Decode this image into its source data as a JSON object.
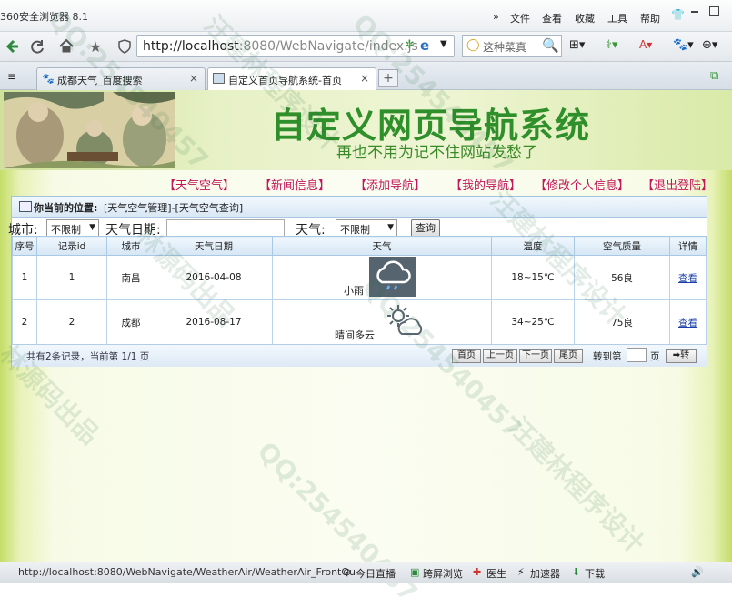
{
  "browser": {
    "app_title": "360安全浏览器 8.1",
    "menu": [
      "»",
      "文件",
      "查看",
      "收藏",
      "工具",
      "帮助"
    ],
    "address_host": "http://localhost",
    "address_rest": ":8080/WebNavigate/index.js",
    "search_placeholder": "这种菜真",
    "tabs": [
      {
        "label": "成都天气_百度搜索",
        "close": "×"
      },
      {
        "label": "自定义首页导航系统-首页",
        "close": "×"
      }
    ],
    "new_tab": "+"
  },
  "banner": {
    "title": "自定义网页导航系统",
    "subtitle": "再也不用为记不住网站发愁了"
  },
  "nav_links": [
    "【天气空气】",
    "【新闻信息】",
    "【添加导航】",
    "【我的导航】",
    "【修改个人信息】",
    "【退出登陆】"
  ],
  "breadcrumb": {
    "label": "你当前的位置:",
    "path": "[天气空气管理]-[天气空气查询]"
  },
  "filters": {
    "city_label": "城市:",
    "city_value": "不限制",
    "date_label": "天气日期:",
    "date_value": "",
    "weather_label": "天气:",
    "weather_value": "不限制",
    "search_button": "查询"
  },
  "table": {
    "headers": [
      "序号",
      "记录id",
      "城市",
      "天气日期",
      "天气",
      "温度",
      "空气质量",
      "详情"
    ],
    "rows": [
      {
        "index": "1",
        "id": "1",
        "city": "南昌",
        "date": "2016-04-08",
        "weather": "小雨",
        "weather_icon": "rain-cloud-icon",
        "temp": "18~15℃",
        "air": "56良",
        "detail": "查看"
      },
      {
        "index": "2",
        "id": "2",
        "city": "成都",
        "date": "2016-08-17",
        "weather": "晴间多云",
        "weather_icon": "partly-cloudy-icon",
        "temp": "34~25℃",
        "air": "75良",
        "detail": "查看"
      }
    ]
  },
  "pager": {
    "summary": "共有2条记录，当前第 1/1 页",
    "first": "首页",
    "prev": "上一页",
    "next": "下一页",
    "last": "尾页",
    "goto_label": "转到第",
    "page_unit": "页",
    "go": "➡转"
  },
  "status": {
    "url": "http://localhost:8080/WebNavigate/WeatherAir/WeatherAir_FrontQu",
    "items": [
      "今日直播",
      "跨屏浏览",
      "医生",
      "加速器",
      "下载"
    ]
  },
  "watermarks": [
    "QQ:254540457",
    "汪建林程序设计",
    "林源码出品",
    "QQ:254540457",
    "汪建林程序设计",
    "林源码出品",
    "QQ:254540457",
    "汪建林程序设计"
  ],
  "colors": {
    "banner_green": "#2f8f2a",
    "nav_link": "#c2185b",
    "panel_border": "#9fc3e0"
  }
}
